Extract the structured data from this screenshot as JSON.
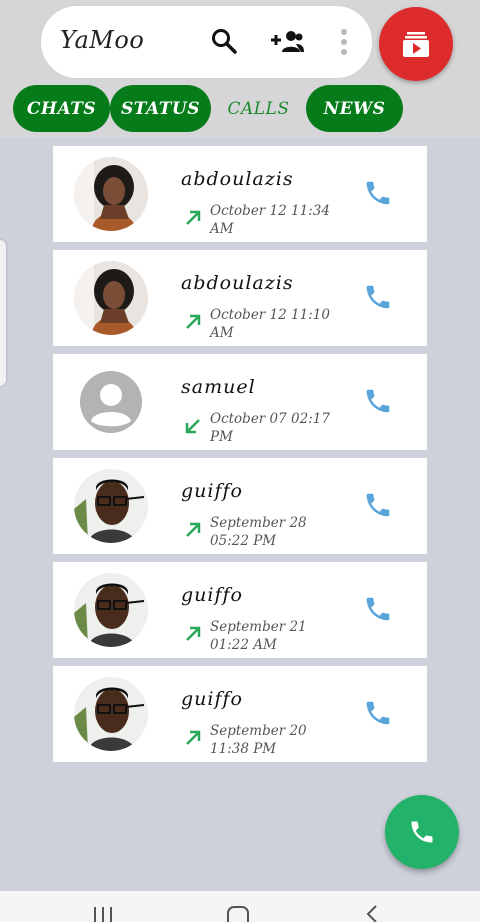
{
  "header": {
    "app_title": "YaMoo",
    "icons": [
      "search-icon",
      "add-person-icon",
      "more-vert-icon",
      "video-icon"
    ]
  },
  "tabs": [
    {
      "label": "CHATS",
      "active": false
    },
    {
      "label": "STATUS",
      "active": false
    },
    {
      "label": "CALLS",
      "active": true
    },
    {
      "label": "NEWS",
      "active": false
    }
  ],
  "calls": [
    {
      "name": "abdoulazis",
      "time": "October 12 11:34 AM",
      "direction": "outgoing"
    },
    {
      "name": "abdoulazis",
      "time": "October 12 11:10 AM",
      "direction": "outgoing"
    },
    {
      "name": "samuel",
      "time": "October 07 02:17 PM",
      "direction": "incoming"
    },
    {
      "name": "guiffo",
      "time": "September 28 05:22 PM",
      "direction": "outgoing"
    },
    {
      "name": "guiffo",
      "time": "September 21 01:22 AM",
      "direction": "outgoing"
    },
    {
      "name": "guiffo",
      "time": "September 20 11:38 PM",
      "direction": "outgoing"
    }
  ],
  "colors": {
    "tab_green": "#057b1a",
    "arrow_green": "#2aa65a",
    "phone_blue": "#5aa6db",
    "fab_red": "#de2c2c",
    "fab_green": "#23b26a"
  }
}
